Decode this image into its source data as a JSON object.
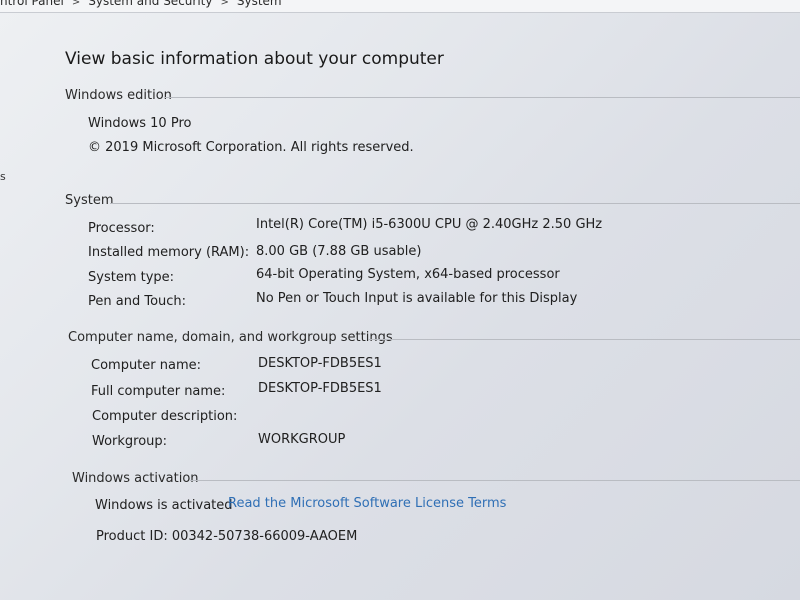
{
  "breadcrumb": {
    "items": [
      "ntrol Panel",
      "System and Security",
      "System"
    ],
    "separator": ">"
  },
  "side_glyph": "s",
  "page_title": "View basic information about your computer",
  "windows_edition": {
    "header": "Windows edition",
    "edition": "Windows 10 Pro",
    "copyright": "© 2019 Microsoft Corporation. All rights reserved."
  },
  "system": {
    "header": "System",
    "rows": [
      {
        "label": "Processor:",
        "value": "Intel(R) Core(TM) i5-6300U CPU @ 2.40GHz   2.50 GHz"
      },
      {
        "label": "Installed memory (RAM):",
        "value": "8.00 GB (7.88 GB usable)"
      },
      {
        "label": "System type:",
        "value": "64-bit Operating System, x64-based processor"
      },
      {
        "label": "Pen and Touch:",
        "value": "No Pen or Touch Input is available for this Display"
      }
    ]
  },
  "computer_name": {
    "header": "Computer name, domain, and workgroup settings",
    "rows": [
      {
        "label": "Computer name:",
        "value": "DESKTOP-FDB5ES1"
      },
      {
        "label": "Full computer name:",
        "value": "DESKTOP-FDB5ES1"
      },
      {
        "label": "Computer description:",
        "value": ""
      },
      {
        "label": "Workgroup:",
        "value": "WORKGROUP"
      }
    ]
  },
  "activation": {
    "header": "Windows activation",
    "status": "Windows is activated",
    "license_link": "Read the Microsoft Software License Terms",
    "product_id": "Product ID: 00342-50738-66009-AAOEM"
  },
  "colors": {
    "link": "#2f6fb5",
    "text": "#202020",
    "rule": "#b9bcc2"
  }
}
